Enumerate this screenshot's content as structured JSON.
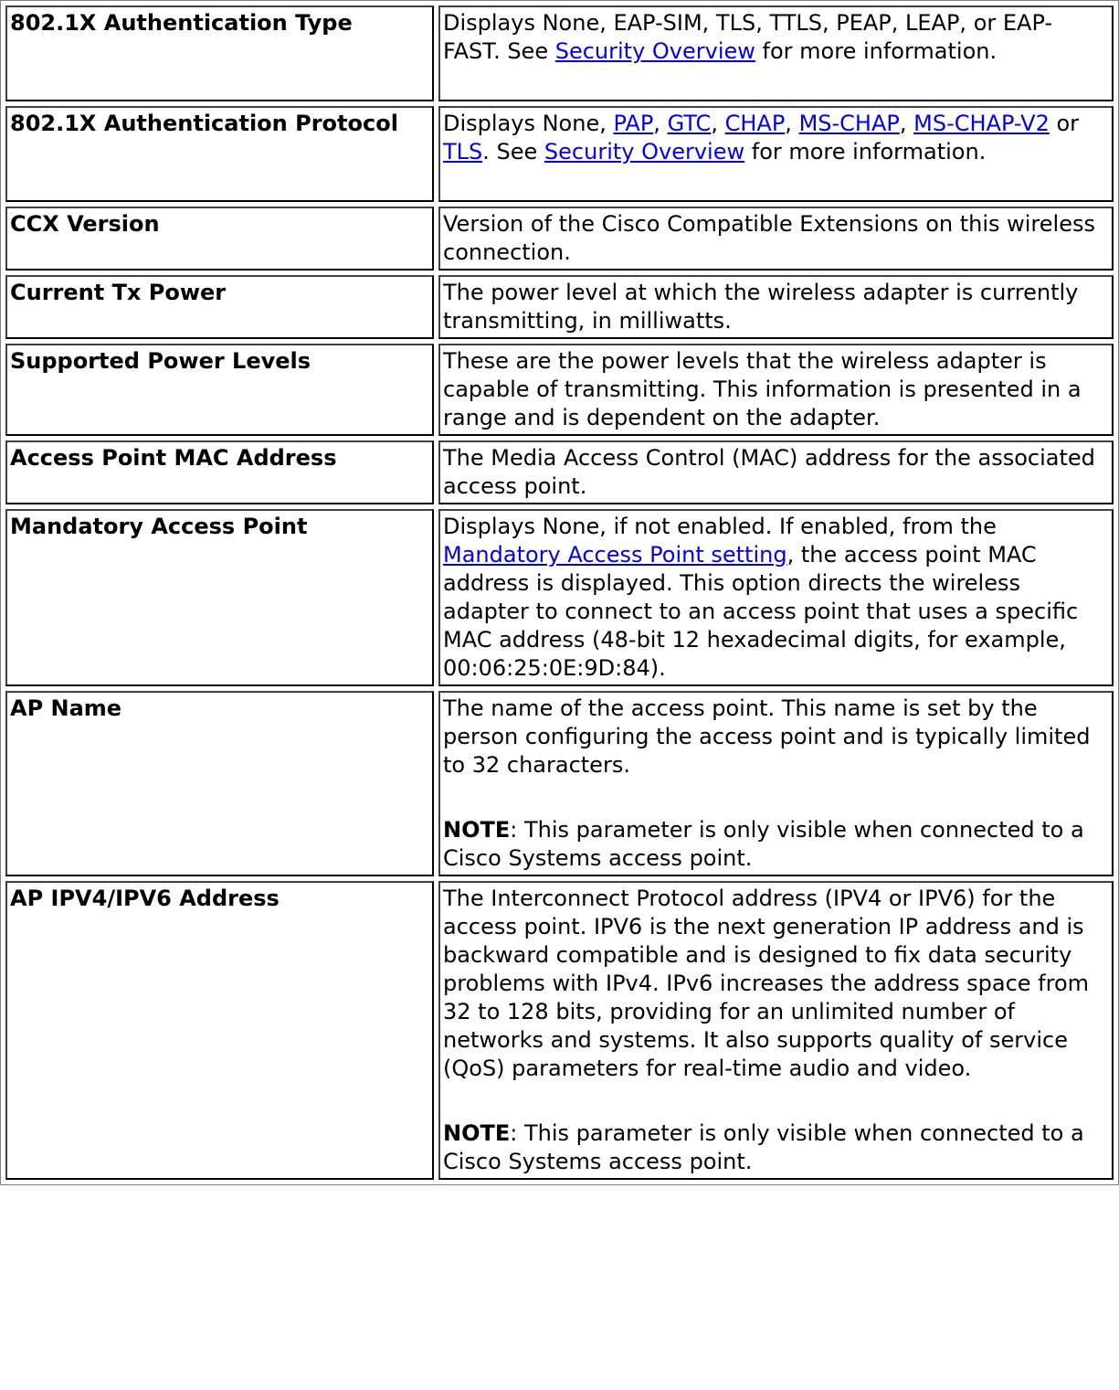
{
  "rows": [
    {
      "name": "802.1X Authentication Type",
      "desc": {
        "t1": "Displays None, EAP-SIM, TLS, TTLS, PEAP, LEAP, or EAP-FAST. See ",
        "link1": "Security Overview",
        "t2": " for more information."
      }
    },
    {
      "name": "802.1X Authentication Protocol",
      "desc": {
        "t1": "Displays None, ",
        "pap": "PAP",
        "sep1": ", ",
        "gtc": "GTC",
        "sep2": ", ",
        "chap": "CHAP",
        "sep3": ", ",
        "mschap": "MS-CHAP",
        "sep4": ", ",
        "mschapv2": "MS-CHAP-V2",
        "or": " or ",
        "tls": "TLS",
        "t2": ". See ",
        "link1": "Security Overview",
        "t3": " for more information."
      }
    },
    {
      "name": "CCX Version",
      "desc": "Version of the Cisco Compatible Extensions on this wireless connection."
    },
    {
      "name": "Current Tx Power",
      "desc": "The power level at which the wireless adapter is currently transmitting, in milliwatts."
    },
    {
      "name": "Supported Power Levels",
      "desc": "These are the power levels that the wireless adapter is capable of transmitting. This information is presented in a range and is dependent on the adapter."
    },
    {
      "name": "Access Point MAC Address",
      "desc": "The Media Access Control (MAC) address for the associated access point."
    },
    {
      "name": "Mandatory Access Point",
      "desc": {
        "t1": "Displays None, if not enabled. If enabled, from the ",
        "link1": "Mandatory Access Point setting",
        "t2": ", the access point MAC address is displayed. This option directs the wireless adapter to connect to an access point that uses a specific MAC address (48-bit 12 hexadecimal digits, for example, 00:06:25:0E:9D:84)."
      }
    },
    {
      "name": "AP Name",
      "desc": {
        "t1": "The name of the access point. This name is set by the person configuring the access point and is typically limited to 32 characters.",
        "note_label": "NOTE",
        "note_text": ": This parameter is only visible when connected to a Cisco Systems access point."
      }
    },
    {
      "name": "AP IPV4/IPV6 Address",
      "desc": {
        "t1": "The Interconnect Protocol address (IPV4 or IPV6) for the access point. IPV6 is the next generation IP address and is backward compatible and is designed to fix data security problems with IPv4. IPv6 increases the address space from 32 to 128 bits, providing for an unlimited number of networks and systems. It also supports quality of service (QoS) parameters for real-time audio and video.",
        "note_label": "NOTE",
        "note_text": ": This parameter is only visible when connected to a Cisco Systems access point."
      }
    }
  ],
  "colors": {
    "link": "#0000ee",
    "text": "#000000",
    "border": "#000000"
  }
}
